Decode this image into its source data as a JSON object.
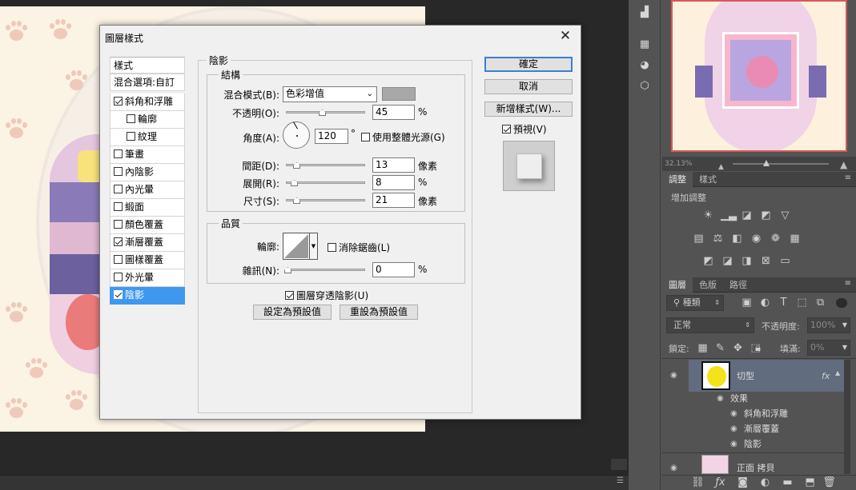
{
  "dialog": {
    "title": "圖層樣式",
    "style_list": {
      "header": "樣式",
      "blend_options": "混合選項:自訂",
      "items": [
        {
          "label": "斜角和浮雕",
          "checked": true
        },
        {
          "label": "輪廓",
          "checked": false
        },
        {
          "label": "紋理",
          "checked": false
        },
        {
          "label": "筆畫",
          "checked": false
        },
        {
          "label": "內陰影",
          "checked": false
        },
        {
          "label": "內光暈",
          "checked": false
        },
        {
          "label": "緞面",
          "checked": false
        },
        {
          "label": "顏色覆蓋",
          "checked": false
        },
        {
          "label": "漸層覆蓋",
          "checked": true
        },
        {
          "label": "圖樣覆蓋",
          "checked": false
        },
        {
          "label": "外光暈",
          "checked": false
        },
        {
          "label": "陰影",
          "checked": true
        }
      ]
    },
    "section_title": "陰影",
    "structure": {
      "title": "結構",
      "blend_mode_label": "混合模式(B):",
      "blend_mode_value": "色彩增值",
      "shadow_color": "#a8a8a8",
      "opacity_label": "不透明(O):",
      "opacity_value": "45",
      "opacity_unit": "%",
      "angle_label": "角度(A):",
      "angle_value": "120",
      "angle_unit": "°",
      "global_light_label": "使用整體光源(G)",
      "distance_label": "間距(D):",
      "distance_value": "13",
      "distance_unit": "像素",
      "spread_label": "展開(R):",
      "spread_value": "8",
      "spread_unit": "%",
      "size_label": "尺寸(S):",
      "size_value": "21",
      "size_unit": "像素"
    },
    "quality": {
      "title": "品質",
      "contour_label": "輪廓:",
      "anti_alias_label": "消除鋸齒(L)",
      "noise_label": "雜訊(N):",
      "noise_value": "0",
      "noise_unit": "%"
    },
    "knockout_label": "圖層穿透陰影(U)",
    "set_default": "設定為預設值",
    "reset_default": "重設為預設值",
    "ok": "確定",
    "cancel": "取消",
    "new_style": "新增樣式(W)...",
    "preview_label": "預視(V)"
  },
  "navigator": {
    "zoom": "32.13%"
  },
  "adjustments": {
    "tab1": "調整",
    "tab2": "樣式",
    "title": "增加調整"
  },
  "layers": {
    "tab1": "圖層",
    "tab2": "色版",
    "tab3": "路徑",
    "filter_kind": "種類",
    "blend": "正常",
    "opacity_label": "不透明度:",
    "opacity_value": "100%",
    "lock_label": "鎖定:",
    "fill_label": "填滿:",
    "fill_value": "0%",
    "rows": {
      "layer1": "切型",
      "fx": "fx",
      "effects": "效果",
      "e1": "斜角和浮雕",
      "e2": "漸層覆蓋",
      "e3": "陰影",
      "layer2": "正面 拷貝"
    }
  }
}
